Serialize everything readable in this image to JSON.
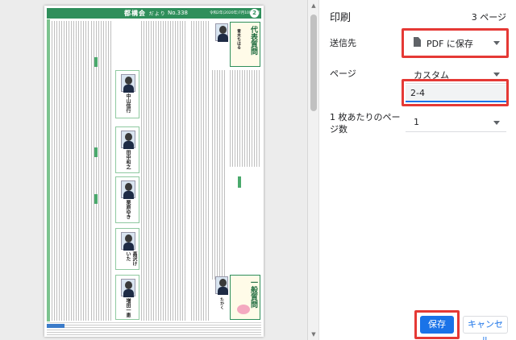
{
  "preview": {
    "header_title": "都構会",
    "header_sub": "だより",
    "header_issue": "No.338",
    "header_date": "令和2年(2020年)7月10日発行",
    "page_number": "2",
    "sections": {
      "representative": "代表質問",
      "general": "一般質問"
    },
    "speakers": [
      {
        "name": "青木ちはる"
      },
      {
        "name": "中山信行"
      },
      {
        "name": "田中和之"
      },
      {
        "name": "栗原ゆき"
      },
      {
        "name": "高沢けいた"
      },
      {
        "name": "増田一恵"
      },
      {
        "name": "たかく"
      }
    ]
  },
  "panel": {
    "title": "印刷",
    "page_count": "3 ページ",
    "destination": {
      "label": "送信先",
      "value": "PDF に保存"
    },
    "pages": {
      "label": "ページ",
      "value": "カスタム",
      "input_value": "2-4"
    },
    "per_sheet": {
      "label": "1 枚あたりのページ数",
      "value": "1"
    },
    "save_label": "保存",
    "cancel_label": "キャンセル"
  },
  "colors": {
    "accent": "#1a73e8",
    "highlight": "#e53935",
    "newsletter_green": "#2f8f5b"
  }
}
